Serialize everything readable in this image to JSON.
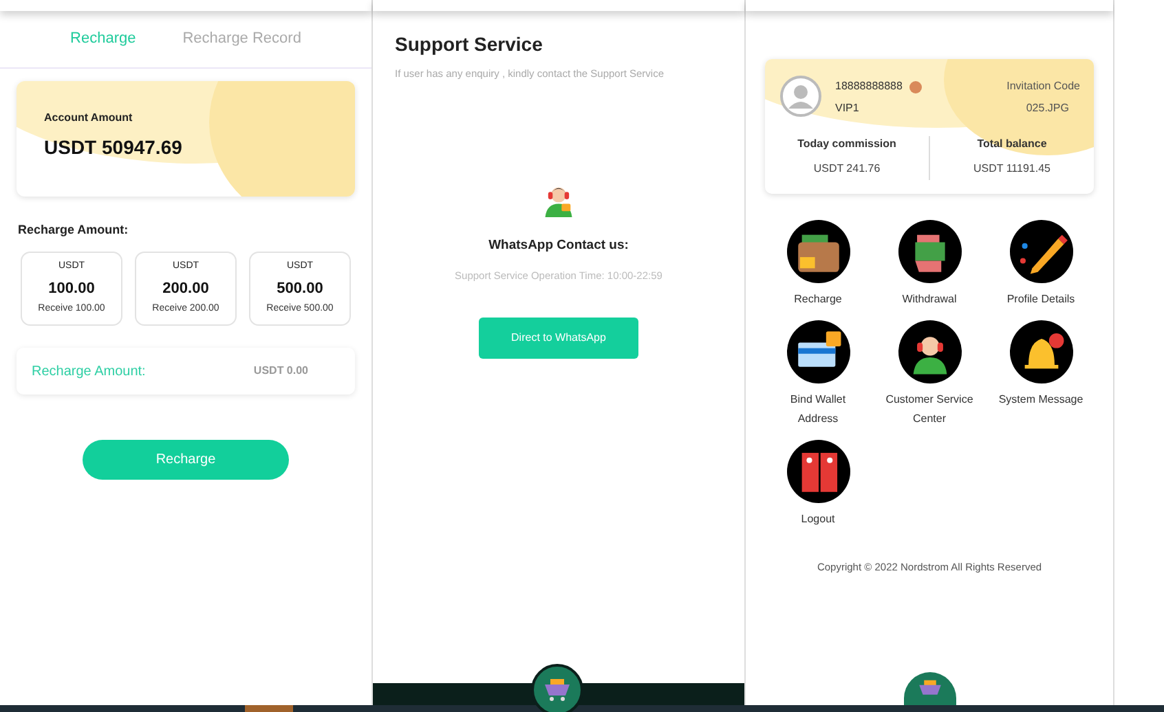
{
  "recharge": {
    "tabs": [
      {
        "label": "Recharge",
        "selected": true
      },
      {
        "label": "Recharge Record",
        "selected": false
      }
    ],
    "account": {
      "label": "Account Amount",
      "amount": "USDT 50947.69"
    },
    "section_title": "Recharge Amount:",
    "options": [
      {
        "currency": "USDT",
        "amount": "100.00",
        "receive": "Receive 100.00",
        "selected": false
      },
      {
        "currency": "USDT",
        "amount": "200.00",
        "receive": "Receive 200.00",
        "selected": false
      },
      {
        "currency": "USDT",
        "amount": "500.00",
        "receive": "Receive 500.00",
        "selected": false
      }
    ],
    "amount_field": {
      "label": "Recharge Amount:",
      "value": "USDT 0.00"
    },
    "button": "Recharge"
  },
  "support": {
    "title": "Support Service",
    "subtitle": "If user has any enquiry , kindly contact the Support Service",
    "contact_title": "WhatsApp Contact us:",
    "hours": "Support Service Operation Time: 10:00-22:59",
    "button": "Direct to WhatsApp"
  },
  "profile": {
    "phone": "18888888888",
    "level": "VIP1",
    "invitation_label": "Invitation Code",
    "invitation_value": "025.JPG",
    "stats": [
      {
        "label": "Today commission",
        "value": "USDT 241.76"
      },
      {
        "label": "Total balance",
        "value": "USDT 11191.45"
      }
    ],
    "menu": [
      {
        "label": "Recharge",
        "kind": "wallet"
      },
      {
        "label": "Withdrawal",
        "kind": "cash"
      },
      {
        "label": "Profile Details",
        "kind": "pencil"
      },
      {
        "label": "Bind Wallet Address",
        "kind": "card"
      },
      {
        "label": "Customer Service Center",
        "kind": "agent"
      },
      {
        "label": "System Message",
        "kind": "bell"
      },
      {
        "label": "Logout",
        "kind": "door"
      }
    ],
    "copyright": "Copyright © 2022 Nordstrom All Rights Reserved"
  }
}
